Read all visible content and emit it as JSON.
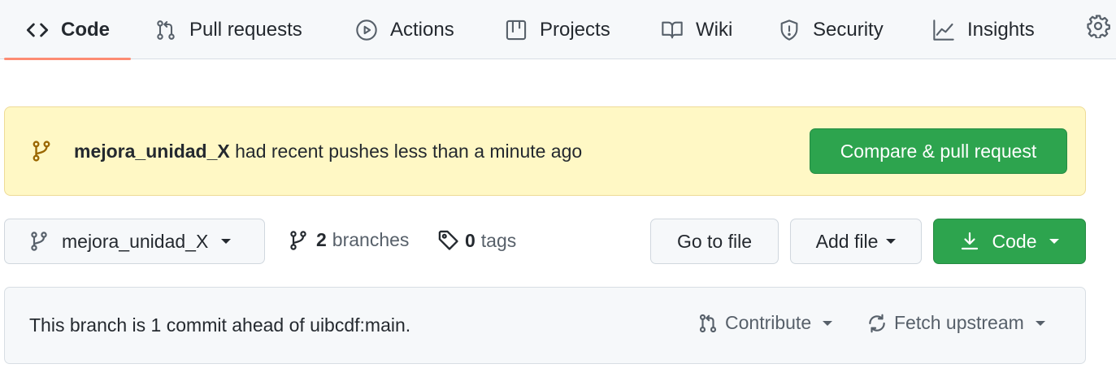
{
  "tabs": [
    {
      "label": "Code",
      "icon": "code-icon",
      "active": true
    },
    {
      "label": "Pull requests",
      "icon": "git-pull-request-icon",
      "active": false
    },
    {
      "label": "Actions",
      "icon": "play-circle-icon",
      "active": false
    },
    {
      "label": "Projects",
      "icon": "table-icon",
      "active": false
    },
    {
      "label": "Wiki",
      "icon": "book-icon",
      "active": false
    },
    {
      "label": "Security",
      "icon": "shield-icon",
      "active": false
    },
    {
      "label": "Insights",
      "icon": "graph-icon",
      "active": false
    }
  ],
  "banner": {
    "branch": "mejora_unidad_X",
    "message": " had recent pushes less than a minute ago",
    "button_label": "Compare & pull request"
  },
  "branch_bar": {
    "current_branch": "mejora_unidad_X",
    "branches_count": "2",
    "branches_label": "branches",
    "tags_count": "0",
    "tags_label": "tags",
    "goto_label": "Go to file",
    "addfile_label": "Add file",
    "code_label": "Code"
  },
  "ahead": {
    "message": "This branch is 1 commit ahead of uibcdf:main.",
    "contribute_label": "Contribute",
    "fetch_label": "Fetch upstream"
  },
  "colors": {
    "accent_underline": "#fd8c73",
    "primary_green": "#2da44e",
    "banner_bg": "#fff8c5"
  }
}
